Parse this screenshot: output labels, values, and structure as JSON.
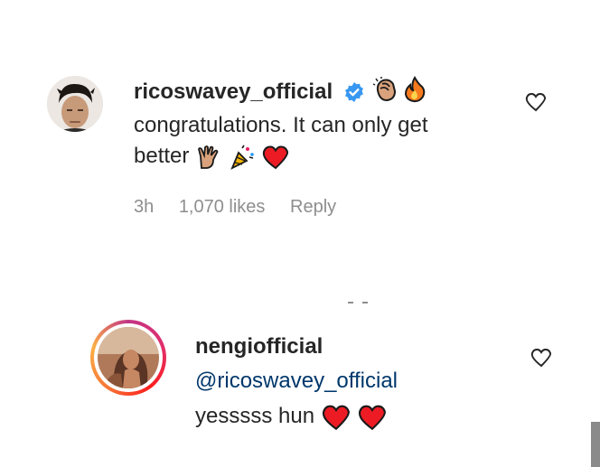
{
  "comments": [
    {
      "username": "ricoswavey_official",
      "verified": true,
      "header_emojis": [
        "clapping-hands-icon",
        "fire-icon"
      ],
      "text_line1": "congratulations. It can only get",
      "text_line2": "better",
      "text_emojis": [
        "vulcan-salute-icon",
        "party-popper-icon",
        "red-heart-icon"
      ],
      "time": "3h",
      "likes": "1,070 likes",
      "reply_label": "Reply"
    },
    {
      "username": "nengiofficial",
      "mention": "@ricoswavey_official",
      "text": "yesssss hun",
      "text_emojis": [
        "red-heart-icon",
        "red-heart-icon"
      ],
      "has_story_ring": true
    }
  ],
  "colors": {
    "text": "#262626",
    "meta": "#8e8e8e",
    "mention": "#00376b",
    "verified": "#3897f0",
    "heart": "#ed1c24"
  }
}
